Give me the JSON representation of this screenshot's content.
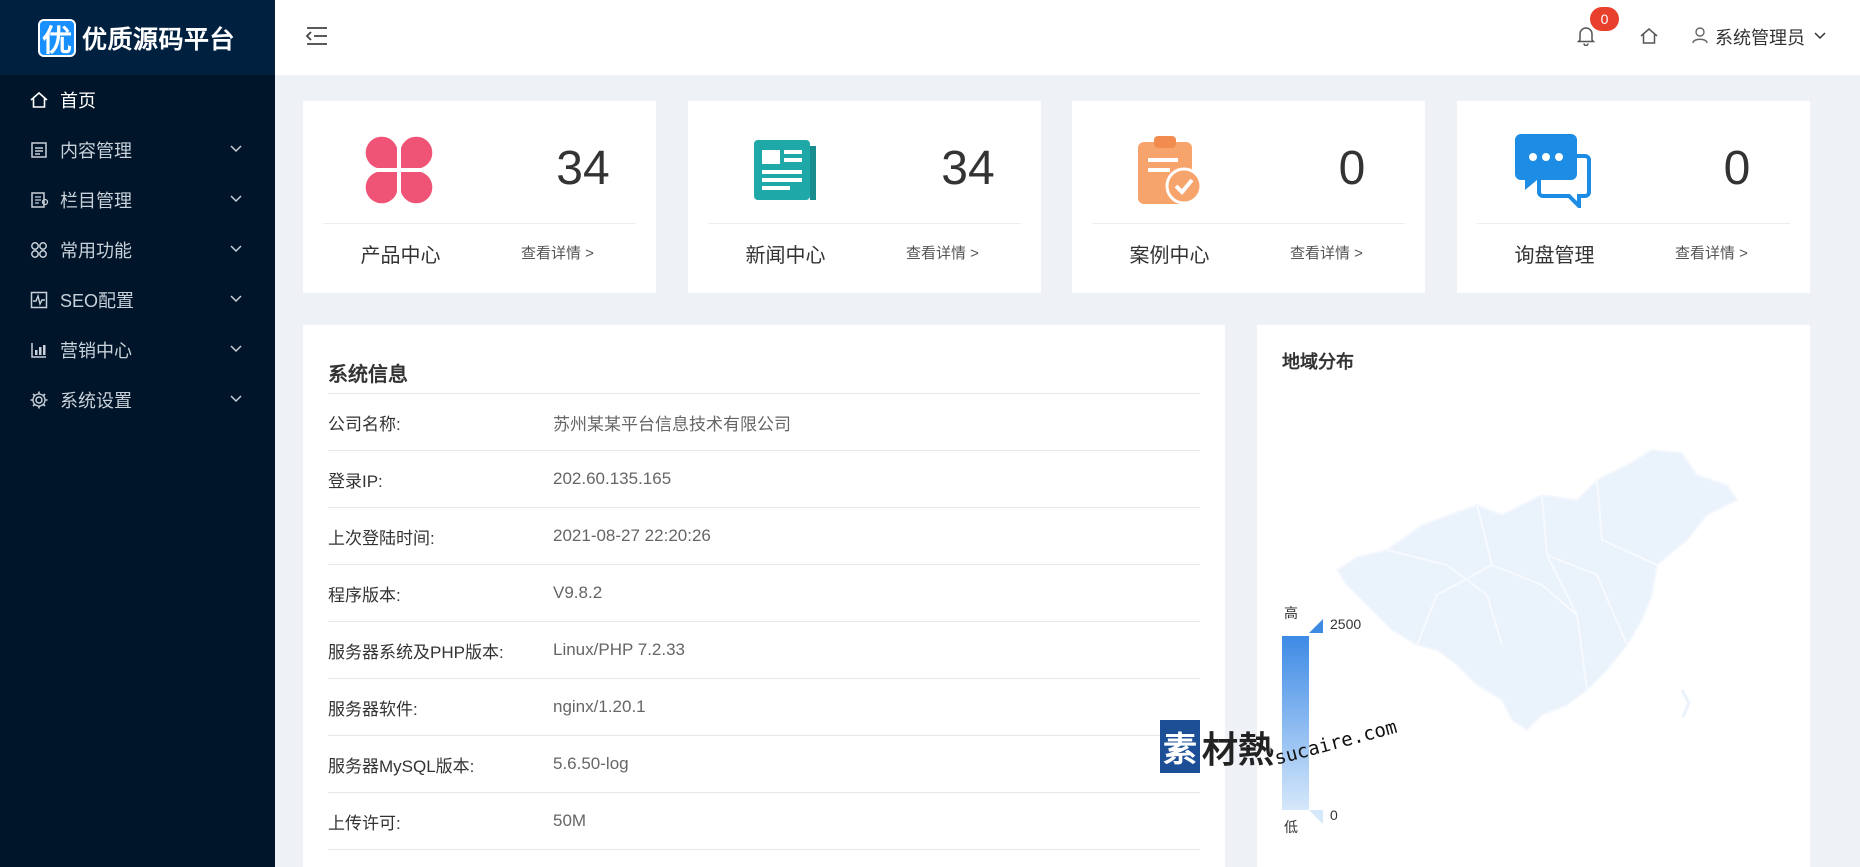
{
  "app": {
    "logo_char": "优",
    "logo_text": "优质源码平台"
  },
  "sidebar": {
    "items": [
      {
        "label": "首页",
        "icon": "home-icon",
        "active": true
      },
      {
        "label": "内容管理",
        "icon": "document-icon"
      },
      {
        "label": "栏目管理",
        "icon": "column-icon"
      },
      {
        "label": "常用功能",
        "icon": "grid-icon"
      },
      {
        "label": "SEO配置",
        "icon": "pulse-icon"
      },
      {
        "label": "营销中心",
        "icon": "bar-chart-icon"
      },
      {
        "label": "系统设置",
        "icon": "gear-icon"
      }
    ]
  },
  "header": {
    "notification_count": "0",
    "user_name": "系统管理员"
  },
  "cards": [
    {
      "title": "产品中心",
      "count": "34",
      "link": "查看详情 >",
      "icon": "clover-icon",
      "color": "#ef5477"
    },
    {
      "title": "新闻中心",
      "count": "34",
      "link": "查看详情 >",
      "icon": "newspaper-icon",
      "color": "#1fa8a8"
    },
    {
      "title": "案例中心",
      "count": "0",
      "link": "查看详情 >",
      "icon": "clipboard-check-icon",
      "color": "#f7a36c"
    },
    {
      "title": "询盘管理",
      "count": "0",
      "link": "查看详情 >",
      "icon": "chat-bubbles-icon",
      "color": "#1c8ce4"
    }
  ],
  "system_info": {
    "title": "系统信息",
    "rows": [
      {
        "label": "公司名称:",
        "value": "苏州某某平台信息技术有限公司"
      },
      {
        "label": "登录IP:",
        "value": "202.60.135.165"
      },
      {
        "label": "上次登陆时间:",
        "value": "2021-08-27 22:20:26"
      },
      {
        "label": "程序版本:",
        "value": "V9.8.2"
      },
      {
        "label": "服务器系统及PHP版本:",
        "value": "Linux/PHP 7.2.33"
      },
      {
        "label": "服务器软件:",
        "value": "nginx/1.20.1"
      },
      {
        "label": "服务器MySQL版本:",
        "value": "5.6.50-log"
      },
      {
        "label": "上传许可:",
        "value": "50M"
      }
    ]
  },
  "map": {
    "title": "地域分布",
    "legend_high": "高",
    "legend_low": "低",
    "legend_max": "2500",
    "legend_min": "0",
    "high_color": "#3d8ae5",
    "low_color": "#d6e8fb",
    "region_color": "#eaf2fc"
  },
  "watermark": {
    "box": "素",
    "text": "材熱",
    "url": "sucaire.com"
  }
}
